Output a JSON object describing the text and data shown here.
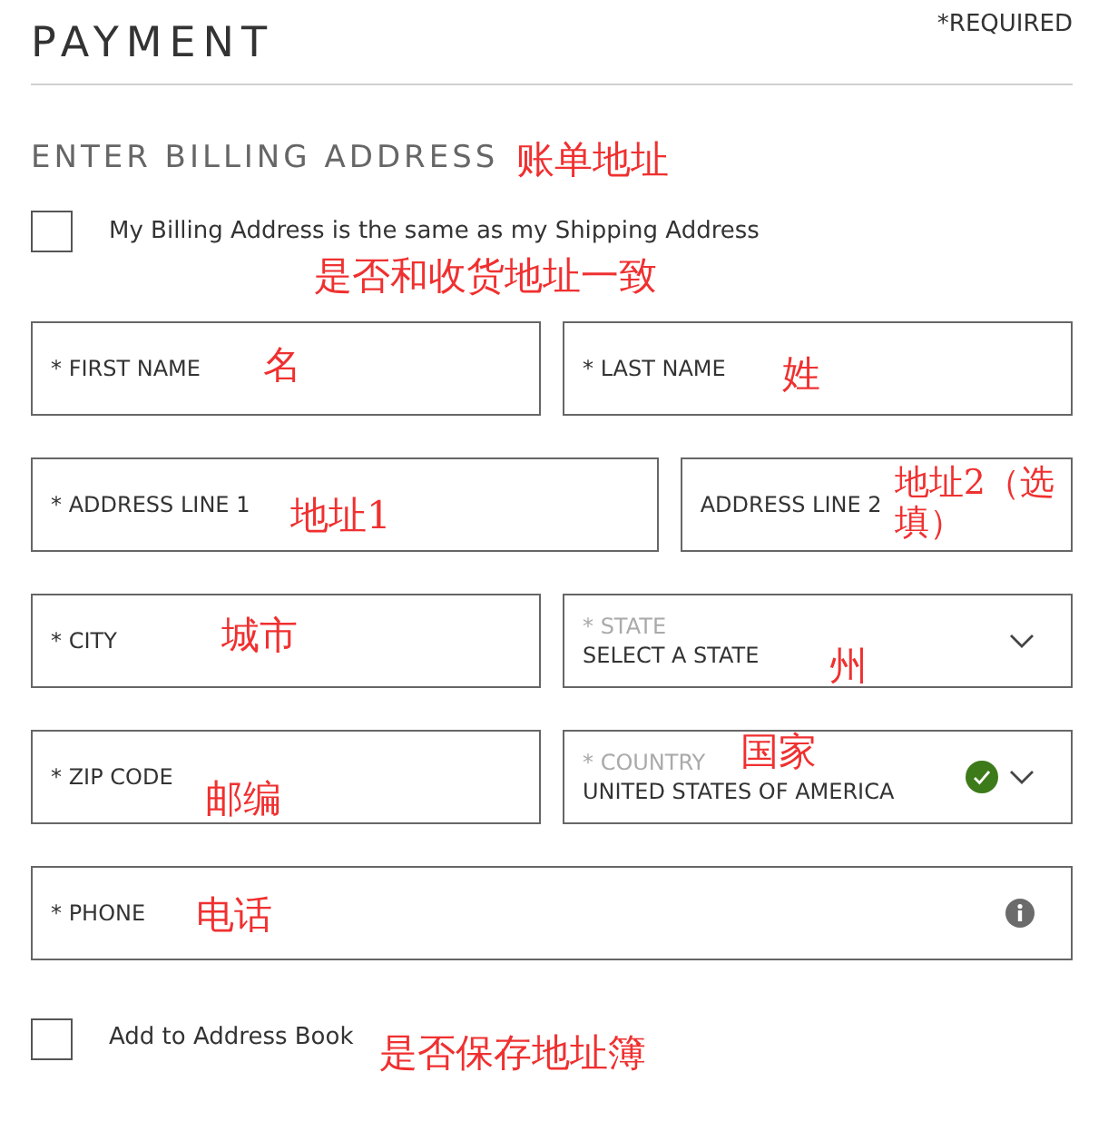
{
  "header": {
    "title": "PAYMENT",
    "required_note": "*REQUIRED"
  },
  "section": {
    "title": "ENTER BILLING ADDRESS",
    "annotation": "账单地址"
  },
  "same_as_shipping": {
    "label": "My Billing Address is the same as my Shipping Address",
    "checked": false,
    "annotation": "是否和收货地址一致"
  },
  "rows": [
    {
      "kind": "even",
      "fields": [
        {
          "kind": "text",
          "label": "* FIRST NAME",
          "annotation": "名"
        },
        {
          "kind": "text",
          "label": "* LAST NAME",
          "annotation": "姓"
        }
      ]
    },
    {
      "kind": "uneven",
      "fields": [
        {
          "kind": "text",
          "label": "* ADDRESS LINE 1",
          "annotation": "地址1"
        },
        {
          "kind": "text",
          "label": "ADDRESS LINE 2",
          "annotation": "地址2（选填）"
        }
      ]
    },
    {
      "kind": "even",
      "fields": [
        {
          "kind": "text",
          "label": "* CITY",
          "annotation": "城市"
        },
        {
          "kind": "select",
          "label": "* STATE",
          "value": "SELECT A STATE",
          "valid": false,
          "annotation": "州"
        }
      ]
    },
    {
      "kind": "even",
      "fields": [
        {
          "kind": "text",
          "label": "* ZIP CODE",
          "annotation": "邮编"
        },
        {
          "kind": "select",
          "label": "* COUNTRY",
          "value": "UNITED STATES OF AMERICA",
          "valid": true,
          "annotation": "国家"
        }
      ]
    },
    {
      "kind": "even",
      "fields": [
        {
          "kind": "info",
          "label": "* PHONE",
          "annotation": "电话"
        }
      ]
    }
  ],
  "address_book": {
    "label": "Add to Address Book",
    "checked": false,
    "annotation": "是否保存地址簿"
  }
}
